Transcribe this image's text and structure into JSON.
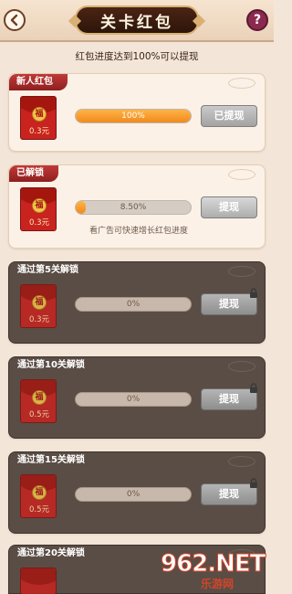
{
  "header": {
    "title": "关卡红包",
    "help": "?"
  },
  "subtitle": "红包进度达到100%可以提现",
  "cards": [
    {
      "tag": "新人红包",
      "amount": "0.3元",
      "progress_text": "100%",
      "progress_fraction": 1.0,
      "button": "已提现",
      "hint": ""
    },
    {
      "tag": "已解锁",
      "amount": "0.3元",
      "progress_text": "8.50%",
      "progress_fraction": 0.085,
      "button": "提现",
      "hint": "看广告可快速增长红包进度"
    },
    {
      "tag": "通过第5关解锁",
      "amount": "0.3元",
      "progress_text": "0%",
      "progress_fraction": 0,
      "button": "提现"
    },
    {
      "tag": "通过第10关解锁",
      "amount": "0.5元",
      "progress_text": "0%",
      "progress_fraction": 0,
      "button": "提现"
    },
    {
      "tag": "通过第15关解锁",
      "amount": "0.5元",
      "progress_text": "0%",
      "progress_fraction": 0,
      "button": "提现"
    },
    {
      "tag": "通过第20关解锁",
      "amount": "",
      "progress_text": "",
      "progress_fraction": 0,
      "button": ""
    }
  ],
  "watermark": {
    "main": "962.NET",
    "sub": "乐游网"
  },
  "colors": {
    "accent": "#c8231f",
    "progress": "#f08a1c",
    "header_dark": "#2e150a"
  }
}
